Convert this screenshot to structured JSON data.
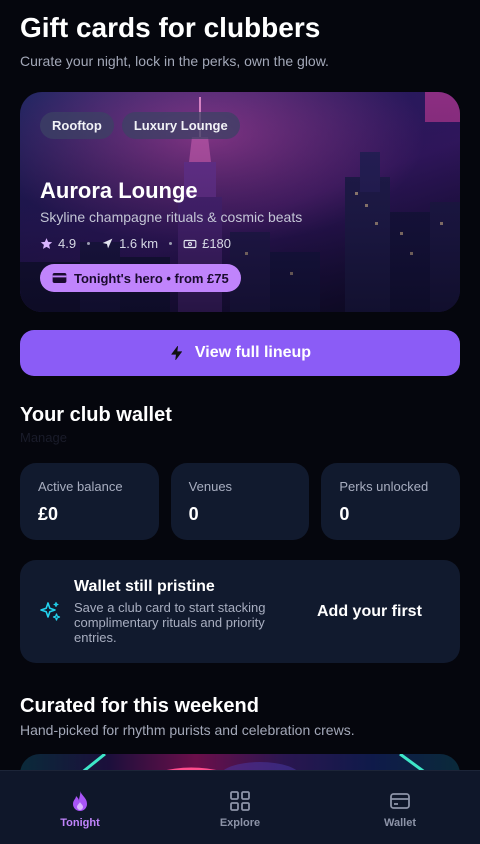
{
  "header": {
    "title": "Gift cards for clubbers",
    "subtitle": "Curate your night, lock in the perks, own the glow."
  },
  "hero": {
    "tags": [
      "Rooftop",
      "Luxury Lounge"
    ],
    "name": "Aurora Lounge",
    "tagline": "Skyline champagne rituals & cosmic beats",
    "rating": "4.9",
    "distance": "1.6 km",
    "price": "£180",
    "pill_label": "Tonight's hero • from £75"
  },
  "cta": {
    "label": "View full lineup"
  },
  "wallet": {
    "title": "Your club wallet",
    "subtitle": "Manage",
    "cards": [
      {
        "label": "Active balance",
        "value": "£0"
      },
      {
        "label": "Venues",
        "value": "0"
      },
      {
        "label": "Perks unlocked",
        "value": "0"
      }
    ],
    "empty": {
      "title": "Wallet still pristine",
      "text": "Save a club card to start stacking complimentary rituals and priority entries.",
      "action": "Add your first"
    }
  },
  "curated": {
    "title": "Curated for this weekend",
    "subtitle": "Hand-picked for rhythm purists and celebration crews."
  },
  "tabbar": {
    "items": [
      {
        "label": "Tonight",
        "icon": "flame-icon",
        "active": true
      },
      {
        "label": "Explore",
        "icon": "grid-icon",
        "active": false
      },
      {
        "label": "Wallet",
        "icon": "wallet-icon",
        "active": false
      }
    ]
  },
  "colors": {
    "background": "#05060d",
    "accent": "#8b5cf6",
    "accent_light": "#c084fc",
    "card": "#111a2e",
    "sparkle": "#22d3ee"
  }
}
